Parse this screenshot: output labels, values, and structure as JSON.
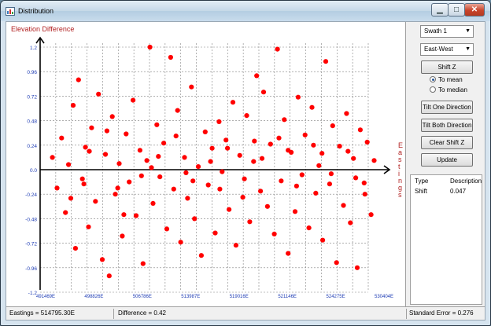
{
  "window": {
    "title": "Distribution"
  },
  "side_panel": {
    "swath_select": "Swath 1",
    "direction_select": "East-West",
    "shift_z_label": "Shift Z",
    "radio_mean": "To mean",
    "radio_median": "To median",
    "radio_selected": "mean",
    "tilt_one_label": "Tilt One Direction",
    "tilt_both_label": "Tilt Both Direction",
    "clear_shift_label": "Clear Shift Z",
    "update_label": "Update",
    "table": {
      "headers": [
        "Type",
        "Description"
      ],
      "rows": [
        [
          "Shift",
          "0.047"
        ]
      ]
    }
  },
  "status": {
    "eastings": "Eastings = 514795.30E",
    "difference": "Difference = 0.42",
    "std_error": "Standard Error = 0.276"
  },
  "colors": {
    "points": "#ff0000",
    "axis_label": "#b22222",
    "tick_label": "#1e3cb4",
    "grid": "#808080"
  },
  "chart_data": {
    "type": "scatter",
    "ylabel": "Elevation Difference",
    "xlabel": "Eastings",
    "ylim": [
      -1.2,
      1.2
    ],
    "xlim": [
      484600,
      530404
    ],
    "y_ticks": [
      "1.2",
      "0.96",
      "0.72",
      "0.48",
      "0.24",
      "0.0",
      "-0.24",
      "-0.48",
      "-0.72",
      "-0.96",
      "-1.2"
    ],
    "x_ticks": [
      "491469E",
      "498826E",
      "506786E",
      "513987E",
      "519016E",
      "521146E",
      "524275E",
      "530404E"
    ],
    "grid": true,
    "series": [
      {
        "values": [
          [
            486200,
            0.12
          ],
          [
            486800,
            -0.18
          ],
          [
            487400,
            0.31
          ],
          [
            487900,
            -0.42
          ],
          [
            488300,
            0.05
          ],
          [
            488900,
            0.63
          ],
          [
            489200,
            -0.77
          ],
          [
            489600,
            0.88
          ],
          [
            490100,
            -0.09
          ],
          [
            490500,
            0.22
          ],
          [
            490900,
            -0.56
          ],
          [
            491300,
            0.41
          ],
          [
            491800,
            -0.31
          ],
          [
            492200,
            0.74
          ],
          [
            492700,
            -0.88
          ],
          [
            493100,
            0.15
          ],
          [
            493600,
            -1.04
          ],
          [
            494000,
            0.52
          ],
          [
            494400,
            -0.24
          ],
          [
            494900,
            0.06
          ],
          [
            495300,
            -0.65
          ],
          [
            495800,
            0.35
          ],
          [
            496200,
            -0.12
          ],
          [
            496700,
            0.68
          ],
          [
            497100,
            -0.45
          ],
          [
            497600,
            0.19
          ],
          [
            498000,
            -0.92
          ],
          [
            498500,
            0.09
          ],
          [
            498900,
            1.2
          ],
          [
            499300,
            -0.33
          ],
          [
            499800,
            0.44
          ],
          [
            500200,
            -0.07
          ],
          [
            500700,
            0.26
          ],
          [
            501100,
            -0.58
          ],
          [
            501600,
            1.1
          ],
          [
            502000,
            -0.19
          ],
          [
            502500,
            0.58
          ],
          [
            502900,
            -0.71
          ],
          [
            503400,
            0.12
          ],
          [
            503800,
            -0.28
          ],
          [
            504300,
            0.81
          ],
          [
            504700,
            -0.48
          ],
          [
            505200,
            0.03
          ],
          [
            505600,
            -0.84
          ],
          [
            506100,
            0.37
          ],
          [
            506500,
            -0.15
          ],
          [
            507000,
            0.21
          ],
          [
            507400,
            -0.62
          ],
          [
            507900,
            0.47
          ],
          [
            508300,
            -0.02
          ],
          [
            508800,
            0.29
          ],
          [
            509200,
            -0.39
          ],
          [
            509700,
            0.66
          ],
          [
            510100,
            -0.74
          ],
          [
            510600,
            0.14
          ],
          [
            511000,
            -0.27
          ],
          [
            511500,
            0.53
          ],
          [
            511900,
            -0.51
          ],
          [
            512400,
            0.08
          ],
          [
            512800,
            0.92
          ],
          [
            513300,
            -0.21
          ],
          [
            513700,
            0.76
          ],
          [
            514200,
            -0.36
          ],
          [
            514600,
            0.25
          ],
          [
            515100,
            -0.63
          ],
          [
            515500,
            1.18
          ],
          [
            516000,
            -0.11
          ],
          [
            516400,
            0.49
          ],
          [
            516900,
            -0.82
          ],
          [
            517300,
            0.17
          ],
          [
            517800,
            -0.41
          ],
          [
            518200,
            0.71
          ],
          [
            518700,
            -0.05
          ],
          [
            519100,
            0.34
          ],
          [
            519600,
            -0.57
          ],
          [
            520000,
            0.61
          ],
          [
            520500,
            -0.23
          ],
          [
            520900,
            0.04
          ],
          [
            521400,
            -0.69
          ],
          [
            521800,
            1.06
          ],
          [
            522300,
            -0.14
          ],
          [
            522700,
            0.43
          ],
          [
            523200,
            -0.91
          ],
          [
            523600,
            0.23
          ],
          [
            524100,
            -0.35
          ],
          [
            524500,
            0.55
          ],
          [
            525000,
            -0.52
          ],
          [
            525400,
            0.11
          ],
          [
            525900,
            -0.96
          ],
          [
            526300,
            0.39
          ],
          [
            526800,
            -0.13
          ],
          [
            527200,
            0.27
          ],
          [
            527700,
            -0.44
          ],
          [
            528100,
            0.09
          ],
          [
            488600,
            -0.28
          ],
          [
            491000,
            0.18
          ],
          [
            493300,
            0.38
          ],
          [
            495500,
            -0.44
          ],
          [
            497800,
            -0.06
          ],
          [
            500000,
            0.13
          ],
          [
            502300,
            0.33
          ],
          [
            504500,
            -0.11
          ],
          [
            506800,
            0.08
          ],
          [
            509000,
            0.21
          ],
          [
            511200,
            -0.09
          ],
          [
            513500,
            0.11
          ],
          [
            515700,
            0.31
          ],
          [
            518000,
            -0.16
          ],
          [
            520200,
            0.24
          ],
          [
            522500,
            -0.04
          ],
          [
            524700,
            0.18
          ],
          [
            526900,
            -0.24
          ],
          [
            490300,
            -0.14
          ],
          [
            494700,
            -0.18
          ],
          [
            499100,
            0.02
          ],
          [
            503600,
            -0.03
          ],
          [
            508000,
            -0.19
          ],
          [
            512500,
            0.28
          ],
          [
            516900,
            0.19
          ],
          [
            521300,
            0.16
          ],
          [
            525700,
            -0.08
          ]
        ]
      }
    ]
  }
}
